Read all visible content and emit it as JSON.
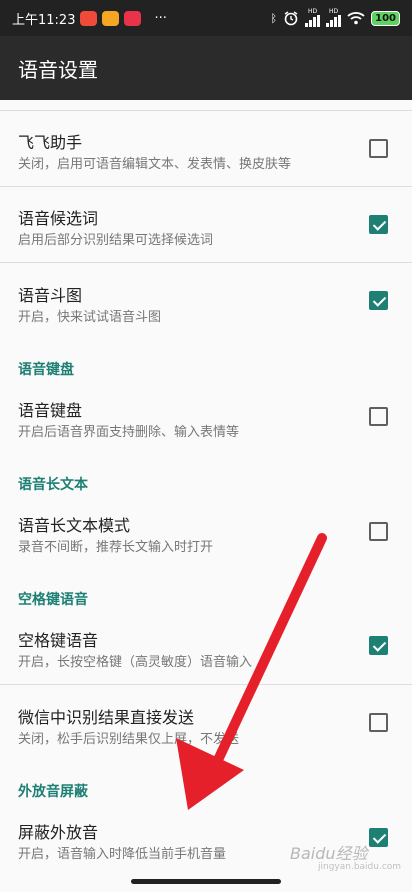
{
  "status_bar": {
    "time": "上午11:23",
    "more": "···",
    "hd1": "HD",
    "hd2": "HD",
    "battery": "100",
    "icons": [
      "app-red-icon",
      "weibo-icon",
      "app-badge-icon",
      "bluetooth-icon",
      "alarm-icon",
      "signal-icon",
      "wifi-icon",
      "battery-icon"
    ]
  },
  "app_bar": {
    "title": "语音设置"
  },
  "prefs": [
    {
      "title": "飞飞助手",
      "summary": "关闭，启用可语音编辑文本、发表情、换皮肤等",
      "checked": false
    },
    {
      "title": "语音候选词",
      "summary": "启用后部分识别结果可选择候选词",
      "checked": true
    },
    {
      "title": "语音斗图",
      "summary": "开启，快来试试语音斗图",
      "checked": true
    },
    {
      "title": "语音键盘",
      "summary": "开启后语音界面支持删除、输入表情等",
      "checked": false
    },
    {
      "title": "语音长文本模式",
      "summary": "录音不间断，推荐长文输入时打开",
      "checked": false
    },
    {
      "title": "空格键语音",
      "summary": "开启，长按空格键（高灵敏度）语音输入",
      "checked": true
    },
    {
      "title": "微信中识别结果直接发送",
      "summary": "关闭，松手后识别结果仅上屏，不发送",
      "checked": false
    },
    {
      "title": "屏蔽外放音",
      "summary": "开启，语音输入时降低当前手机音量",
      "checked": true
    }
  ],
  "categories": [
    "语音键盘",
    "语音长文本",
    "空格键语音",
    "外放音屏蔽"
  ],
  "watermark": {
    "main": "Baidu经验",
    "sub": "jingyan.baidu.com"
  },
  "colors": {
    "accent": "#1e7f74",
    "app_bar": "#2b2b2b",
    "arrow": "#e5202a"
  }
}
